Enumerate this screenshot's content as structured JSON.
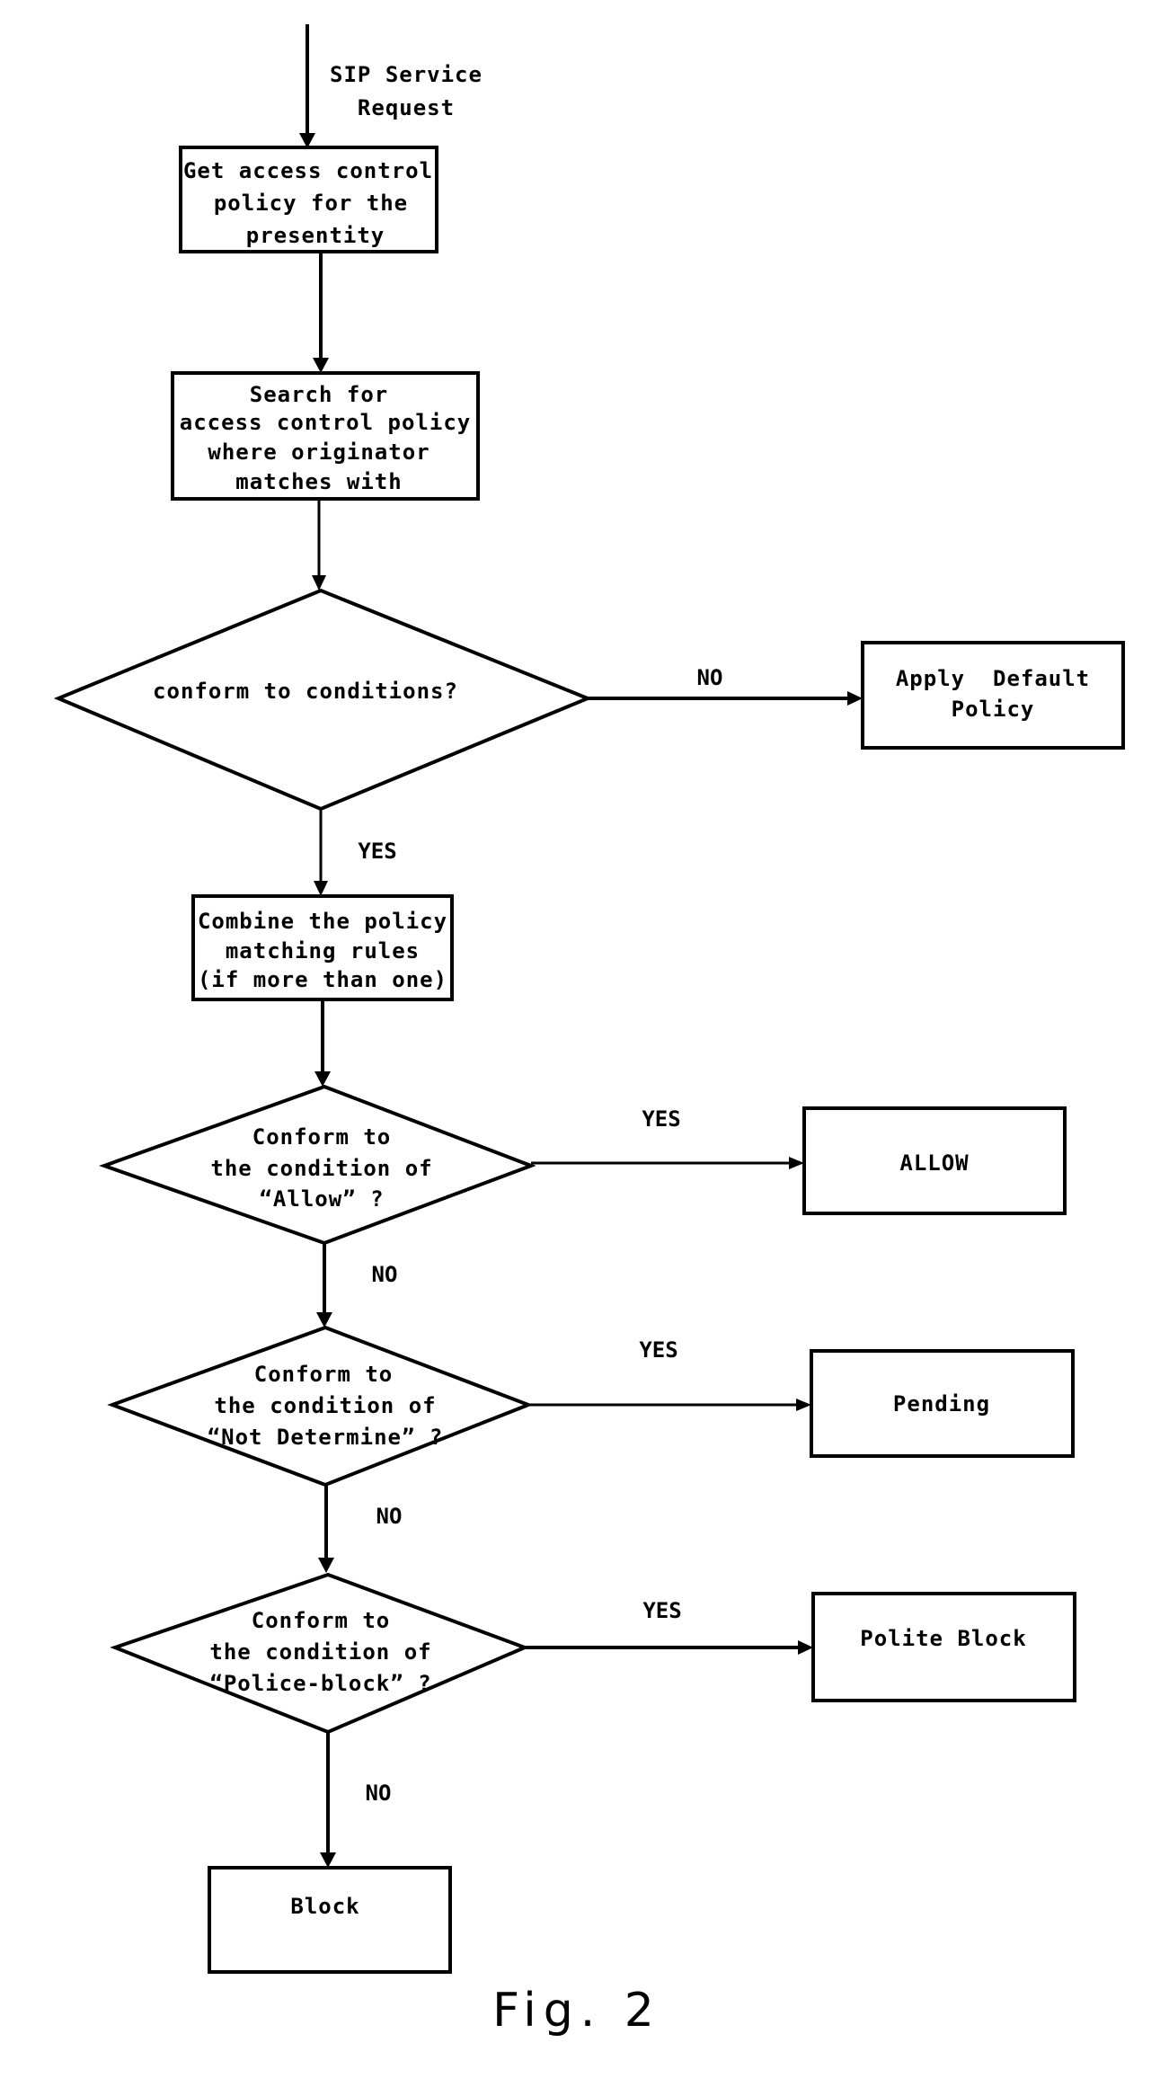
{
  "diagram": {
    "type": "flowchart",
    "caption": "Fig. 2",
    "entry": {
      "label_lines": [
        "SIP Service",
        "Request"
      ]
    },
    "nodes": [
      {
        "id": "get-policy",
        "kind": "process",
        "label_lines": [
          "Get access control",
          "policy for the",
          "presentity"
        ]
      },
      {
        "id": "search-policy",
        "kind": "process",
        "label_lines": [
          "Search for",
          "access control policy",
          "where originator",
          "matches with"
        ]
      },
      {
        "id": "conform-conditions",
        "kind": "decision",
        "label_lines": [
          "conform to conditions?"
        ]
      },
      {
        "id": "apply-default",
        "kind": "process",
        "label_lines": [
          "Apply  Default",
          "Policy"
        ]
      },
      {
        "id": "combine-rules",
        "kind": "process",
        "label_lines": [
          "Combine the policy",
          "matching rules",
          "(if more than one)"
        ]
      },
      {
        "id": "cond-allow",
        "kind": "decision",
        "label_lines": [
          "Conform to",
          "the condition of",
          "“Allow” ?"
        ]
      },
      {
        "id": "allow",
        "kind": "process",
        "label_lines": [
          "ALLOW"
        ]
      },
      {
        "id": "cond-not-determine",
        "kind": "decision",
        "label_lines": [
          "Conform to",
          "the condition of",
          "“Not Determine” ?"
        ]
      },
      {
        "id": "pending",
        "kind": "process",
        "label_lines": [
          "Pending"
        ]
      },
      {
        "id": "cond-police-block",
        "kind": "decision",
        "label_lines": [
          "Conform to",
          "the condition of",
          "“Police-block” ?"
        ]
      },
      {
        "id": "polite-block",
        "kind": "process",
        "label_lines": [
          "Polite Block"
        ]
      },
      {
        "id": "block",
        "kind": "process",
        "label_lines": [
          "Block"
        ]
      }
    ],
    "edges": [
      {
        "from": "entry",
        "to": "get-policy",
        "label": ""
      },
      {
        "from": "get-policy",
        "to": "search-policy",
        "label": ""
      },
      {
        "from": "search-policy",
        "to": "conform-conditions",
        "label": ""
      },
      {
        "from": "conform-conditions",
        "to": "apply-default",
        "label": "NO"
      },
      {
        "from": "conform-conditions",
        "to": "combine-rules",
        "label": "YES"
      },
      {
        "from": "combine-rules",
        "to": "cond-allow",
        "label": ""
      },
      {
        "from": "cond-allow",
        "to": "allow",
        "label": "YES"
      },
      {
        "from": "cond-allow",
        "to": "cond-not-determine",
        "label": "NO"
      },
      {
        "from": "cond-not-determine",
        "to": "pending",
        "label": "YES"
      },
      {
        "from": "cond-not-determine",
        "to": "cond-police-block",
        "label": "NO"
      },
      {
        "from": "cond-police-block",
        "to": "polite-block",
        "label": "YES"
      },
      {
        "from": "cond-police-block",
        "to": "block",
        "label": "NO"
      }
    ]
  }
}
